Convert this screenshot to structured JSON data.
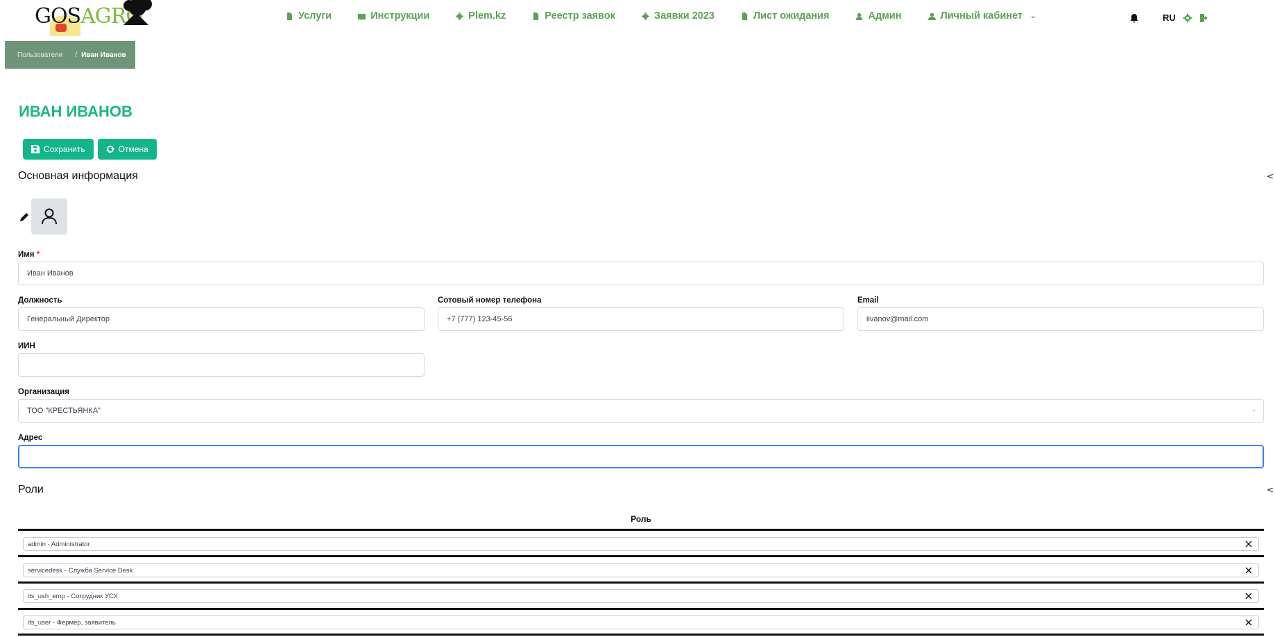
{
  "logo": {
    "part1": "GOS",
    "part2": "AGRO"
  },
  "nav": {
    "items": [
      {
        "label": "Услуги",
        "icon": "document-icon"
      },
      {
        "label": "Инструкции",
        "icon": "book-icon"
      },
      {
        "label": "Plem.kz",
        "icon": "gear-icon"
      },
      {
        "label": "Реестр заявок",
        "icon": "document-icon"
      },
      {
        "label": "Заявки 2023",
        "icon": "gear-icon"
      },
      {
        "label": "Лист ожидания",
        "icon": "document-icon"
      },
      {
        "label": "Админ",
        "icon": "user-gear-icon"
      },
      {
        "label": "Личный кабинет",
        "icon": "user-icon"
      }
    ],
    "lang": "RU"
  },
  "breadcrumb": {
    "parent": "Пользователи",
    "separator": "/",
    "current": "Иван Иванов"
  },
  "page": {
    "title": "ИВАН ИВАНОВ"
  },
  "actions": {
    "save": "Сохранить",
    "cancel": "Отмена"
  },
  "sections": {
    "main_info": "Основная информация",
    "roles": "Роли",
    "collapse_glyph": "<"
  },
  "form": {
    "name": {
      "label": "Имя",
      "required_mark": "*",
      "value": "Иван Иванов"
    },
    "position": {
      "label": "Должность",
      "value": "Генеральный Директор"
    },
    "phone": {
      "label": "Сотовый номер телефона",
      "value": "+7 (777) 123-45-56"
    },
    "email": {
      "label": "Email",
      "value": "iivanov@mail.com"
    },
    "iin": {
      "label": "ИИН",
      "value": ""
    },
    "organization": {
      "label": "Организация",
      "value": "ТОО \"КРЕСТЬЯНКА\""
    },
    "address": {
      "label": "Адрес",
      "value": ""
    }
  },
  "roles": {
    "column_header": "Роль",
    "items": [
      "admin - Administrator",
      "servicedesk - Служба Service Desk",
      "its_ush_emp - Сотрудник УСХ",
      "its_user - Фермер, заявитель"
    ]
  },
  "colors": {
    "nav_green": "#5aa353",
    "title_green": "#1fb48a",
    "button_green": "#14b58a",
    "breadcrumb_bg": "#6f9579",
    "focus_blue": "#3b82f6",
    "required_red": "#d32f2f"
  }
}
